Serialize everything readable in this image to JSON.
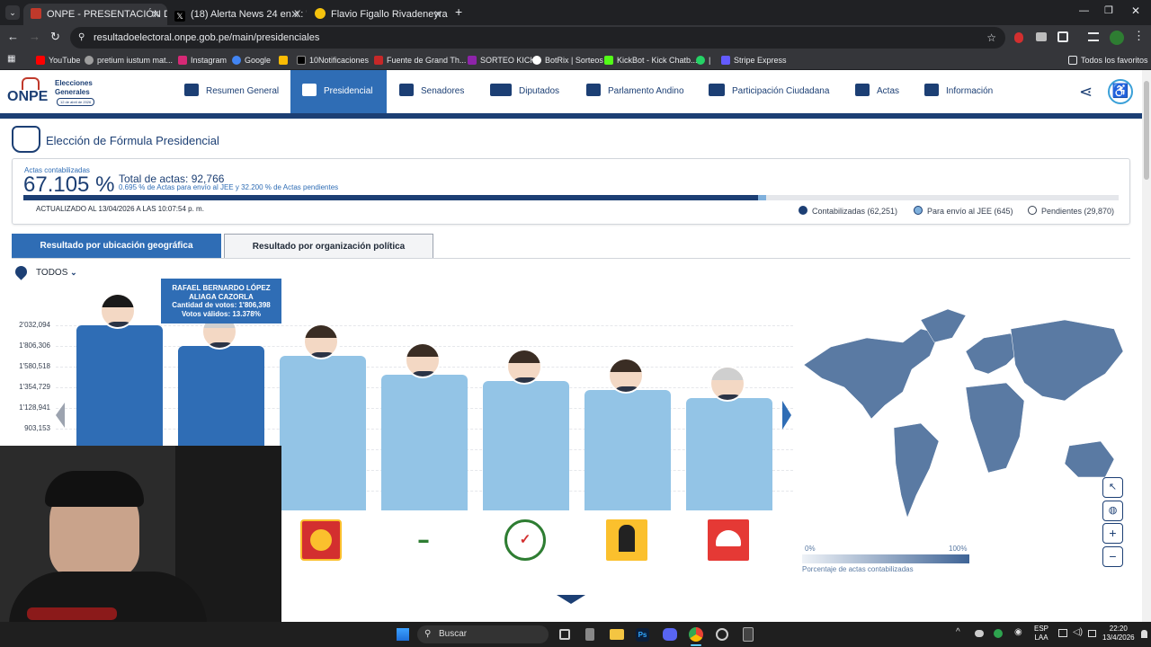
{
  "browser": {
    "tabs": [
      {
        "title": "ONPE - PRESENTACIÓN DE RES",
        "active": true
      },
      {
        "title": "(18) Alerta News 24 en X: \"🇵🇪 | /",
        "active": false
      },
      {
        "title": "Flavio Figallo Rivadeneyra es el",
        "active": false
      }
    ],
    "url": "resultadoelectoral.onpe.gob.pe/main/presidenciales",
    "bookmarks": [
      "YouTube",
      "pretium iustum mat...",
      "Instagram",
      "Google",
      "",
      "10Notificaciones",
      "Fuente de Grand Th...",
      "SORTEO KICK",
      "BotRix | Sorteos",
      "KickBot - Kick Chatb...",
      "|",
      "Stripe Express"
    ],
    "all_bookmarks": "Todos los favoritos"
  },
  "site": {
    "logo": {
      "name": "ONPE",
      "line1": "Elecciones",
      "line2": "Generales",
      "date": "12 de abril de 2026"
    },
    "nav": [
      "Resumen General",
      "Presidencial",
      "Senadores",
      "Diputados",
      "Parlamento Andino",
      "Participación Ciudadana",
      "Actas",
      "Información"
    ],
    "page_title": "Elección de Fórmula Presidencial",
    "actas": {
      "label": "Actas contabilizadas",
      "percent": "67.105 %",
      "total": "Total de actas: 92,766",
      "sub": "0.695 % de Actas para envío al JEE y 32.200 % de Actas pendientes",
      "updated": "ACTUALIZADO AL 13/04/2026 A LAS 10:07:54 p. m.",
      "progress_pct": 67.105,
      "jee_pct": 0.695,
      "legend": [
        "Contabilizadas (62,251)",
        "Para envío al JEE (645)",
        "Pendientes (29,870)"
      ]
    },
    "tabs": [
      "Resultado por ubicación geográfica",
      "Resultado por organización política"
    ],
    "filter": "TODOS",
    "tooltip": {
      "name1": "RAFAEL BERNARDO LÓPEZ",
      "name2": "ALIAGA CAZORLA",
      "votes": "Cantidad de votos: 1'806,398",
      "valid": "Votos válidos: 13.378%"
    },
    "scale": {
      "min": "0%",
      "max": "100%",
      "caption": "Porcentaje de actas contabilizadas"
    }
  },
  "chart_data": {
    "type": "bar",
    "yticks": [
      "2'032,094",
      "1'806,306",
      "1'580,518",
      "1'354,729",
      "1'128,941",
      "903,153"
    ],
    "values": [
      2032094,
      1806398,
      1700000,
      1490000,
      1420000,
      1330000,
      1240000
    ],
    "colors": {
      "leader": "#2f6db5",
      "others": "#93c4e6"
    }
  },
  "taskbar": {
    "search": "Buscar",
    "lang1": "ESP",
    "lang2": "LAA",
    "time": "22:20",
    "date": "13/4/2026"
  }
}
